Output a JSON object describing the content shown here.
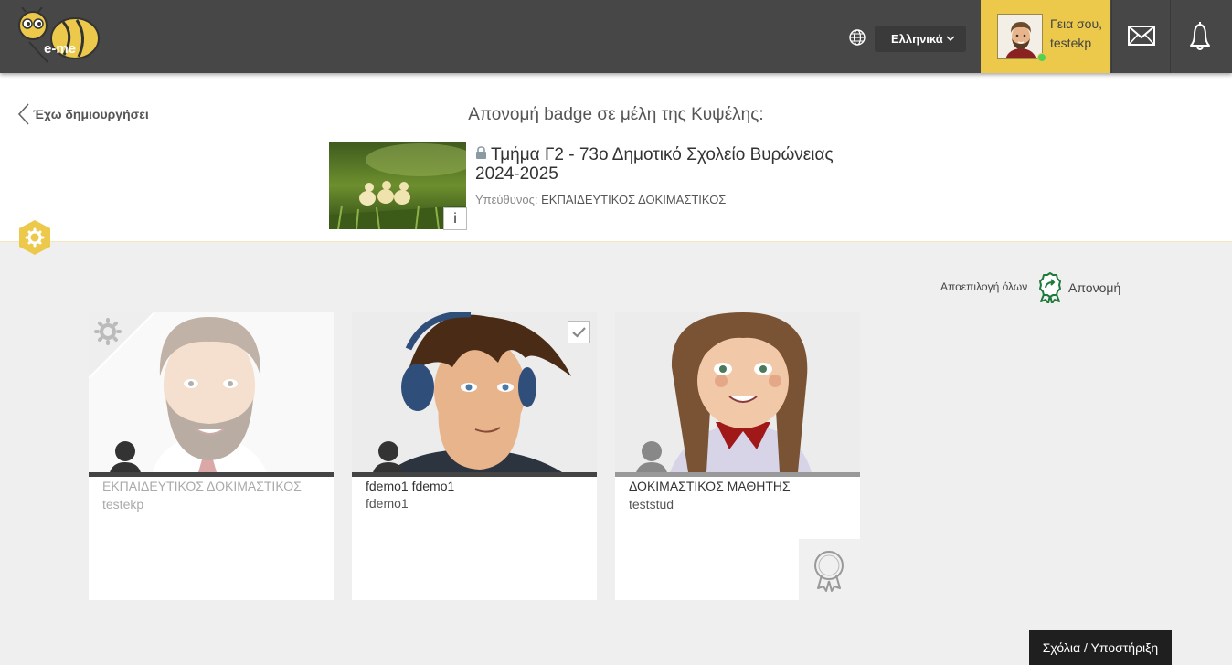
{
  "topbar": {
    "logo_text": "e-me",
    "language": "Ελληνικά",
    "greeting": "Γεια σου,",
    "username": "testekp"
  },
  "header": {
    "back_label": "Έχω δημιουργήσει",
    "page_title": "Απονομή badge σε μέλη της Κυψέλης:",
    "hive_name": "Τμήμα Γ2 - 73ο Δημοτικό Σχολείο Βυρώνειας 2024-2025",
    "responsible_label": "Υπεύθυνος:",
    "responsible_name": "ΕΚΠΑΙΔΕΥΤΙΚΟΣ ΔΟΚΙΜΑΣΤΙΚΟΣ",
    "info_label": "i"
  },
  "actions": {
    "deselect_all": "Αποεπιλογή όλων",
    "award": "Απονομή"
  },
  "members": [
    {
      "full_name": "ΕΚΠΑΙΔΕΥΤΙΚΟΣ ΔΟΚΙΜΑΣΤΙΚΟΣ",
      "username": "testekp",
      "selected": false,
      "disabled": true
    },
    {
      "full_name": "fdemo1 fdemo1",
      "username": "fdemo1",
      "selected": true,
      "disabled": false
    },
    {
      "full_name": "ΔΟΚΙΜΑΣΤΙΚΟΣ ΜΑΘΗΤΗΣ",
      "username": "teststud",
      "selected": false,
      "disabled": false
    }
  ],
  "footer": {
    "feedback": "Σχόλια / Υποστήριξη"
  },
  "colors": {
    "topbar": "#474747",
    "accent_yellow": "#ecc94b",
    "award_green": "#1f7a3c"
  }
}
